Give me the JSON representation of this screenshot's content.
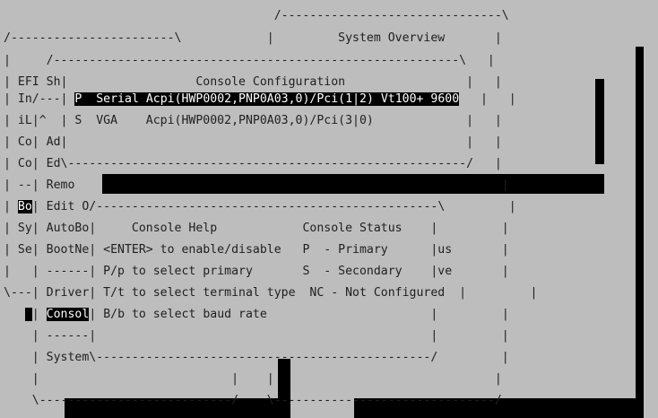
{
  "screen": {
    "lines": [
      "                                      /-------------------------------\\",
      "/-----------------------\\            |         System Overview       |",
      "|     /---------------------------------------------------------\\   |",
      "| EFI Sh|                  Console Configuration                 |   |",
      "| In/---|",
      "| iL|^  | S  VGA    Acpi(HWP0002,PNP0A03,0)/Pci(3|0)             |   |",
      "| Co| Ad|                                                        |   |",
      "| Co| Ed\\--------------------------------------------------------/   |",
      "| --| Remo                                                            |",
      "| ",
      "| Sy| AutoBo|     Console Help            Console Status    |         |",
      "| Se| BootNe| <ENTER> to enable/disable   P  - Primary      |us       |",
      "|   | ------| P/p to select primary       S  - Secondary    |ve       |",
      "\\---| Driver| T/t to select terminal type  NC - Not Configured  |         |",
      "   ",
      "    | ------|                                               |         |",
      "    | System\\-----------------------------------------------/         |",
      "    |                           |    |                               |",
      "    \\---------------------------/    \\-------------------------------/"
    ],
    "selected_console": "P  Serial Acpi(HWP0002,PNP0A03,0)/Pci(1|2) Vt100+ 9600",
    "boot_menu_highlight": "Bo",
    "boot_menu_rest": "| Edit O/------------------------------------------------\\         |",
    "console_menu_item": "Consol",
    "console_menu_rest": "B/b to select baud rate                       |         |"
  }
}
